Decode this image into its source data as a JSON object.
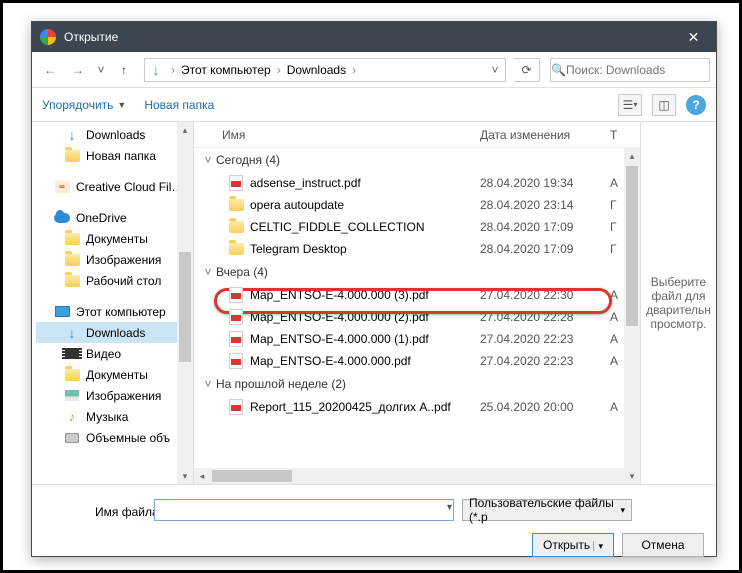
{
  "title": "Открытие",
  "breadcrumb": {
    "pc": "Этот компьютер",
    "folder": "Downloads"
  },
  "search": {
    "placeholder": "Поиск: Downloads"
  },
  "toolbar": {
    "organize": "Упорядочить",
    "newfolder": "Новая папка"
  },
  "tree": {
    "downloadsTop": "Downloads",
    "newFolder": "Новая папка",
    "cc": "Creative Cloud Fil…",
    "onedrive": "OneDrive",
    "docs": "Документы",
    "images": "Изображения",
    "desktop": "Рабочий стол",
    "pc": "Этот компьютер",
    "downloads": "Downloads",
    "video": "Видео",
    "docs2": "Документы",
    "images2": "Изображения",
    "music": "Музыка",
    "volumes": "Объемные объ"
  },
  "headers": {
    "name": "Имя",
    "date": "Дата изменения",
    "type": "Т"
  },
  "groups": {
    "today": {
      "label": "Сегодня (4)",
      "items": [
        {
          "name": "adsense_instruct.pdf",
          "date": "28.04.2020 19:34",
          "t": "A",
          "icon": "pdf"
        },
        {
          "name": "opera autoupdate",
          "date": "28.04.2020 23:14",
          "t": "Г",
          "icon": "folder"
        },
        {
          "name": "CELTIC_FIDDLE_COLLECTION",
          "date": "28.04.2020 17:09",
          "t": "Г",
          "icon": "folder"
        },
        {
          "name": "Telegram Desktop",
          "date": "28.04.2020 17:09",
          "t": "Г",
          "icon": "folder"
        }
      ]
    },
    "yesterday": {
      "label": "Вчера (4)",
      "items": [
        {
          "name": "Map_ENTSO-E-4.000.000 (3).pdf",
          "date": "27.04.2020 22:30",
          "t": "A",
          "icon": "pdf"
        },
        {
          "name": "Map_ENTSO-E-4.000.000 (2).pdf",
          "date": "27.04.2020 22:28",
          "t": "A",
          "icon": "pdf"
        },
        {
          "name": "Map_ENTSO-E-4.000.000 (1).pdf",
          "date": "27.04.2020 22:23",
          "t": "A",
          "icon": "pdf"
        },
        {
          "name": "Map_ENTSO-E-4.000.000.pdf",
          "date": "27.04.2020 22:23",
          "t": "A",
          "icon": "pdf"
        }
      ]
    },
    "lastweek": {
      "label": "На прошлой неделе (2)",
      "items": [
        {
          "name": "Report_115_20200425_долгих A..pdf",
          "date": "25.04.2020 20:00",
          "t": "A",
          "icon": "pdf"
        }
      ]
    }
  },
  "preview": "Выберите файл для дварительн просмотр.",
  "footer": {
    "label": "Имя файла:",
    "filetype": "Пользовательские файлы (*.p",
    "open": "Открыть",
    "cancel": "Отмена"
  }
}
